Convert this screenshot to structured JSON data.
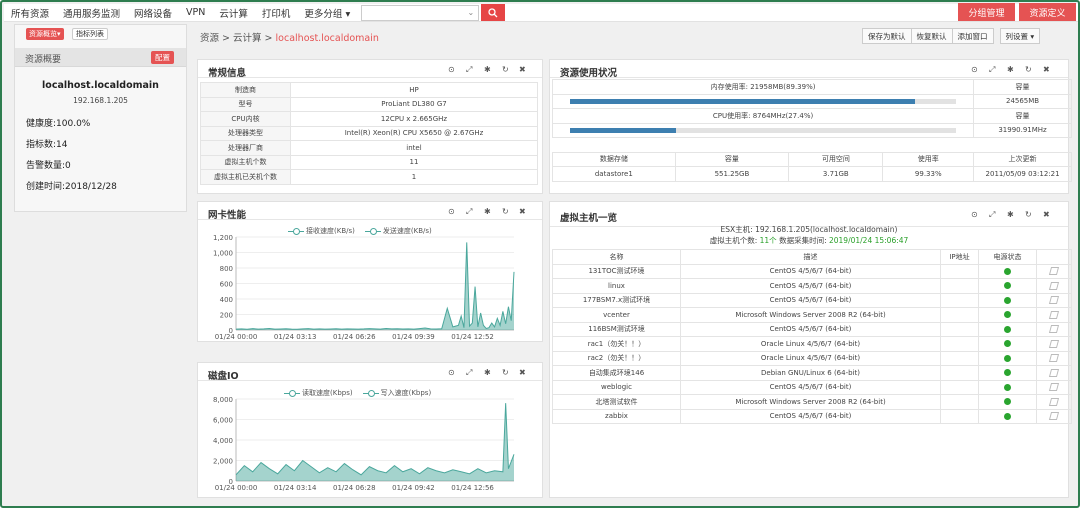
{
  "nav": {
    "items": [
      "所有资源",
      "通用服务监测",
      "网络设备",
      "VPN",
      "云计算",
      "打印机",
      "更多分组 ▾"
    ],
    "group_manage": "分组管理",
    "resource_define": "资源定义"
  },
  "sidebar": {
    "tab_overview": "资源概览▾",
    "tab_metrics": "指标列表",
    "title": "资源概要",
    "config_btn": "配置",
    "hostname": "localhost.localdomain",
    "ip": "192.168.1.205",
    "health": "健康度:100.0%",
    "metrics": "指标数:14",
    "alerts": "告警数量:0",
    "created": "创建时间:2018/12/28"
  },
  "breadcrumb": {
    "a": "资源",
    "sep1": " > ",
    "b": "云计算",
    "sep2": " > ",
    "current": "localhost.localdomain"
  },
  "toolbar": {
    "save_default": "保存为默认",
    "restore_default": "恢复默认",
    "add_window": "添加窗口",
    "columns": "列设置 ▾"
  },
  "general": {
    "title": "常规信息",
    "rows": [
      {
        "k": "制造商",
        "v": "HP"
      },
      {
        "k": "型号",
        "v": "ProLiant DL380 G7"
      },
      {
        "k": "CPU内核",
        "v": "12CPU x 2.665GHz"
      },
      {
        "k": "处理器类型",
        "v": "Intel(R) Xeon(R) CPU X5650 @ 2.67GHz"
      },
      {
        "k": "处理器厂商",
        "v": "intel"
      },
      {
        "k": "虚拟主机个数",
        "v": "11"
      },
      {
        "k": "虚拟主机已关机个数",
        "v": "1"
      }
    ]
  },
  "resource": {
    "title": "资源使用状况",
    "mem_label": "内存使用率: 21958MB(89.39%)",
    "mem_pct": 89.39,
    "cap_header": "容量",
    "mem_cap": "24565MB",
    "cpu_label": "CPU使用率: 8764MHz(27.4%)",
    "cpu_pct": 27.4,
    "cpu_cap": "31990.91MHz",
    "ds_headers": [
      "数据存储",
      "容量",
      "可用空间",
      "使用率",
      "上次更新"
    ],
    "ds_row": [
      "datastore1",
      "551.25GB",
      "3.71GB",
      "99.33%",
      "2011/05/09 03:12:21"
    ]
  },
  "vm": {
    "title": "虚拟主机一览",
    "esx": "ESX主机: 192.168.1.205(localhost.localdomain)",
    "count_prefix": "虚拟主机个数: ",
    "count": "11个",
    "time_prefix": " 数据采集时间: ",
    "time": "2019/01/24 15:06:47",
    "headers": [
      "名称",
      "描述",
      "IP地址",
      "电源状态"
    ],
    "rows": [
      {
        "name": "131TOC测试环境",
        "desc": "CentOS 4/5/6/7 (64-bit)"
      },
      {
        "name": "linux",
        "desc": "CentOS 4/5/6/7 (64-bit)"
      },
      {
        "name": "177BSM7.x测试环境",
        "desc": "CentOS 4/5/6/7 (64-bit)"
      },
      {
        "name": "vcenter",
        "desc": "Microsoft Windows Server 2008 R2 (64-bit)"
      },
      {
        "name": "116BSM测试环境",
        "desc": "CentOS 4/5/6/7 (64-bit)"
      },
      {
        "name": "rac1（勿关！！）",
        "desc": "Oracle Linux 4/5/6/7 (64-bit)"
      },
      {
        "name": "rac2（勿关！！）",
        "desc": "Oracle Linux 4/5/6/7 (64-bit)"
      },
      {
        "name": "自动集成环境146",
        "desc": "Debian GNU/Linux 6 (64-bit)"
      },
      {
        "name": "weblogic",
        "desc": "CentOS 4/5/6/7 (64-bit)"
      },
      {
        "name": "北塔测试软件",
        "desc": "Microsoft Windows Server 2008 R2 (64-bit)"
      },
      {
        "name": "zabbix",
        "desc": "CentOS 4/5/6/7 (64-bit)"
      }
    ]
  },
  "net_panel_title": "网卡性能",
  "disk_panel_title": "磁盘IO",
  "colors": {
    "accent": "#e55353",
    "series": "#4aa79c",
    "bar": "#3d7fb0",
    "ok": "#2aa52f"
  },
  "chart_data": [
    {
      "type": "area",
      "legend": [
        "接收速度(KB/s)",
        "发送速度(KB/s)"
      ],
      "ylim": [
        0,
        1200
      ],
      "yticks": [
        0,
        200,
        400,
        600,
        800,
        1000,
        1200
      ],
      "xticks": [
        "01/24 00:00",
        "01/24 03:13",
        "01/24 06:26",
        "01/24 09:39",
        "01/24 12:52"
      ],
      "x": [
        0,
        2,
        4,
        6,
        8,
        10,
        12,
        14,
        16,
        18,
        20,
        22,
        24,
        26,
        28,
        30,
        32,
        34,
        36,
        38,
        40,
        42,
        44,
        46,
        48,
        50,
        52,
        54,
        56,
        58,
        60,
        62,
        64,
        66,
        68,
        70,
        72,
        74,
        76,
        78,
        80,
        81,
        82,
        83,
        84,
        85,
        86,
        87,
        88,
        89,
        90,
        91,
        92,
        93,
        94,
        95,
        96,
        97,
        98,
        99,
        100
      ],
      "y": [
        12,
        15,
        10,
        18,
        12,
        14,
        20,
        11,
        13,
        16,
        12,
        10,
        15,
        18,
        12,
        14,
        11,
        13,
        16,
        12,
        15,
        13,
        12,
        14,
        18,
        15,
        12,
        20,
        14,
        16,
        13,
        15,
        12,
        18,
        25,
        14,
        13,
        16,
        280,
        40,
        60,
        180,
        30,
        1130,
        50,
        90,
        560,
        40,
        220,
        60,
        20,
        30,
        90,
        40,
        150,
        60,
        240,
        80,
        300,
        120,
        750
      ]
    },
    {
      "type": "area",
      "legend": [
        "读取速度(Kbps)",
        "写入速度(Kbps)"
      ],
      "ylim": [
        0,
        8000
      ],
      "yticks": [
        0,
        2000,
        4000,
        6000,
        8000
      ],
      "xticks": [
        "01/24 00:00",
        "01/24 03:14",
        "01/24 06:28",
        "01/24 09:42",
        "01/24 12:56"
      ],
      "x": [
        0,
        3,
        6,
        9,
        12,
        15,
        18,
        21,
        24,
        27,
        30,
        33,
        36,
        39,
        42,
        45,
        48,
        51,
        54,
        57,
        60,
        63,
        66,
        69,
        72,
        75,
        78,
        81,
        84,
        87,
        90,
        93,
        96,
        97,
        98,
        100
      ],
      "y": [
        600,
        1500,
        900,
        1800,
        1200,
        700,
        1600,
        1000,
        2000,
        1400,
        800,
        1300,
        900,
        1700,
        1100,
        600,
        1400,
        1000,
        800,
        1500,
        900,
        1200,
        700,
        1300,
        1000,
        800,
        1100,
        900,
        700,
        1200,
        800,
        1000,
        900,
        7600,
        1200,
        2600
      ]
    }
  ]
}
